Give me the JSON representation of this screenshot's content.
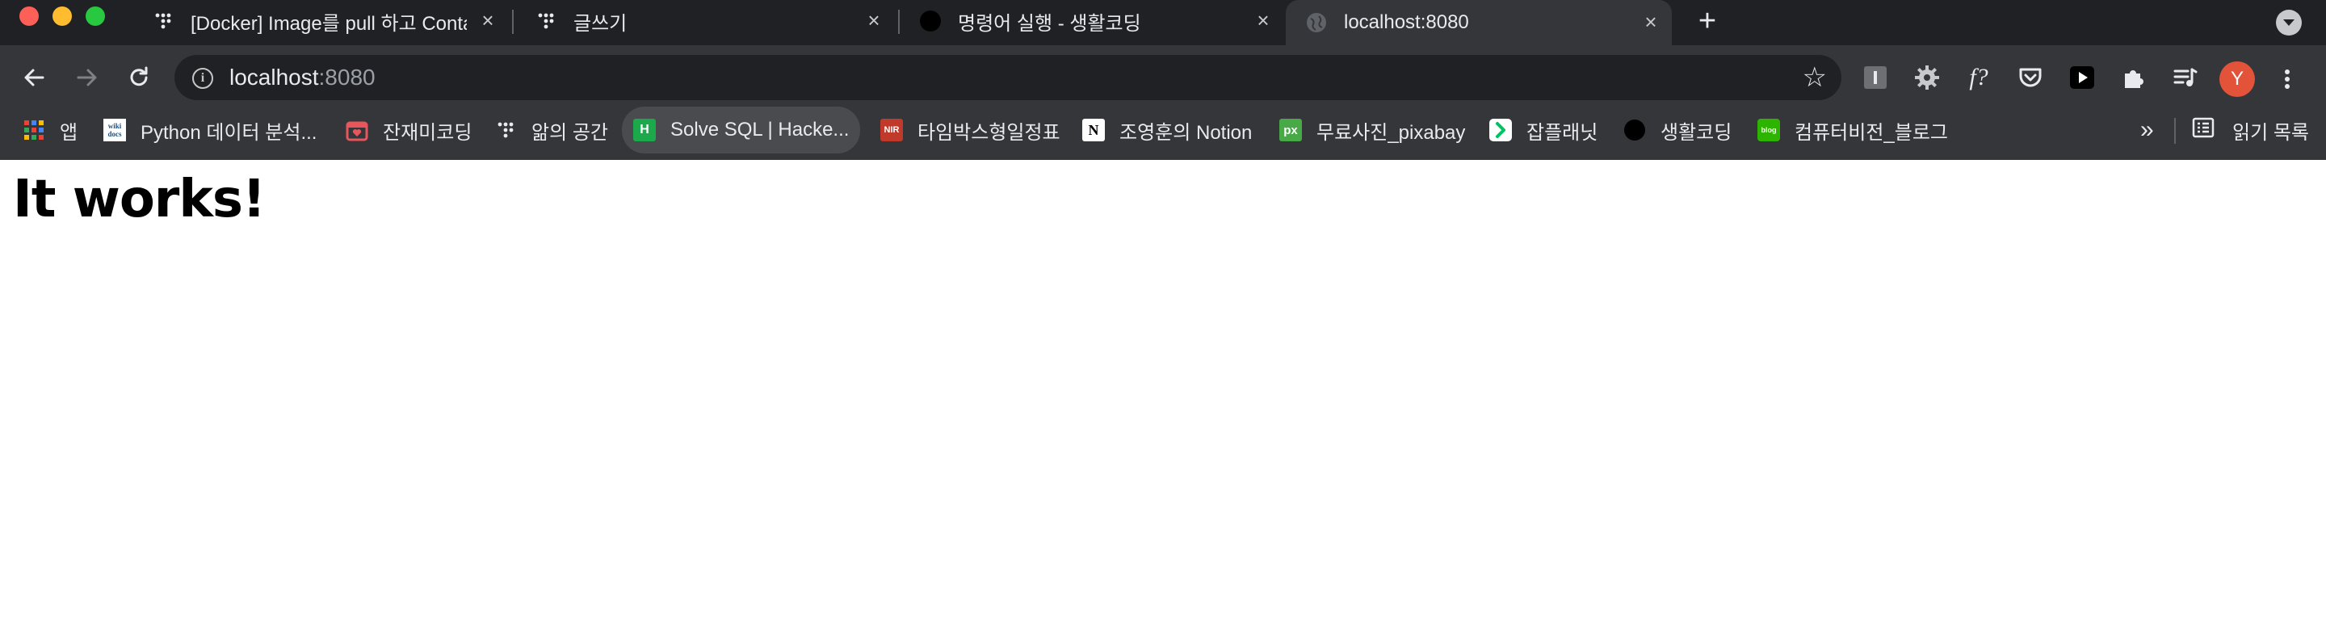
{
  "tabs": [
    {
      "title": "[Docker] Image를 pull 하고 Container",
      "icon": "dots-logo-icon",
      "active": false
    },
    {
      "title": "글쓰기",
      "icon": "dots-logo-icon",
      "active": false
    },
    {
      "title": "명령어 실행 - 생활코딩",
      "icon": "opentutorials-icon",
      "active": false
    },
    {
      "title": "localhost:8080",
      "icon": "globe-icon",
      "active": true
    }
  ],
  "toolbar": {
    "url_host": "localhost",
    "url_port": ":8080",
    "avatar_initial": "Y",
    "extensions": [
      "instapaper-icon",
      "gear-extension-icon",
      "formula-icon",
      "pocket-icon",
      "youtube-icon",
      "puzzle-icon",
      "media-list-icon"
    ]
  },
  "bookmarks": {
    "items": [
      {
        "label": "앱",
        "icon": "apps-grid-icon"
      },
      {
        "label": "Python 데이터 분석...",
        "icon": "wikidocs-icon"
      },
      {
        "label": "잔재미코딩",
        "icon": "calendar-heart-icon"
      },
      {
        "label": "앎의 공간",
        "icon": "dots-logo-icon"
      },
      {
        "label": "Solve SQL | Hacke...",
        "icon": "hackerrank-icon",
        "icon_text": "H"
      },
      {
        "label": "타임박스형일정표",
        "icon": "nir-icon",
        "icon_text": "NIR"
      },
      {
        "label": "조영훈의 Notion",
        "icon": "notion-icon",
        "icon_text": "N"
      },
      {
        "label": "무료사진_pixabay",
        "icon": "pixabay-icon",
        "icon_text": "px"
      },
      {
        "label": "잡플래닛",
        "icon": "jobplanet-icon"
      },
      {
        "label": "생활코딩",
        "icon": "opentutorials-icon"
      },
      {
        "label": "컴퓨터비전_블로그",
        "icon": "blog-icon",
        "icon_text": "blog"
      }
    ],
    "more": "»",
    "reading_list": "읽기 목록"
  },
  "page": {
    "heading": "It works!"
  },
  "colors": {
    "tab_strip": "#202124",
    "toolbar": "#35363a",
    "omnibox": "#202124",
    "avatar": "#e2533a",
    "page_background": "#ffffff"
  }
}
